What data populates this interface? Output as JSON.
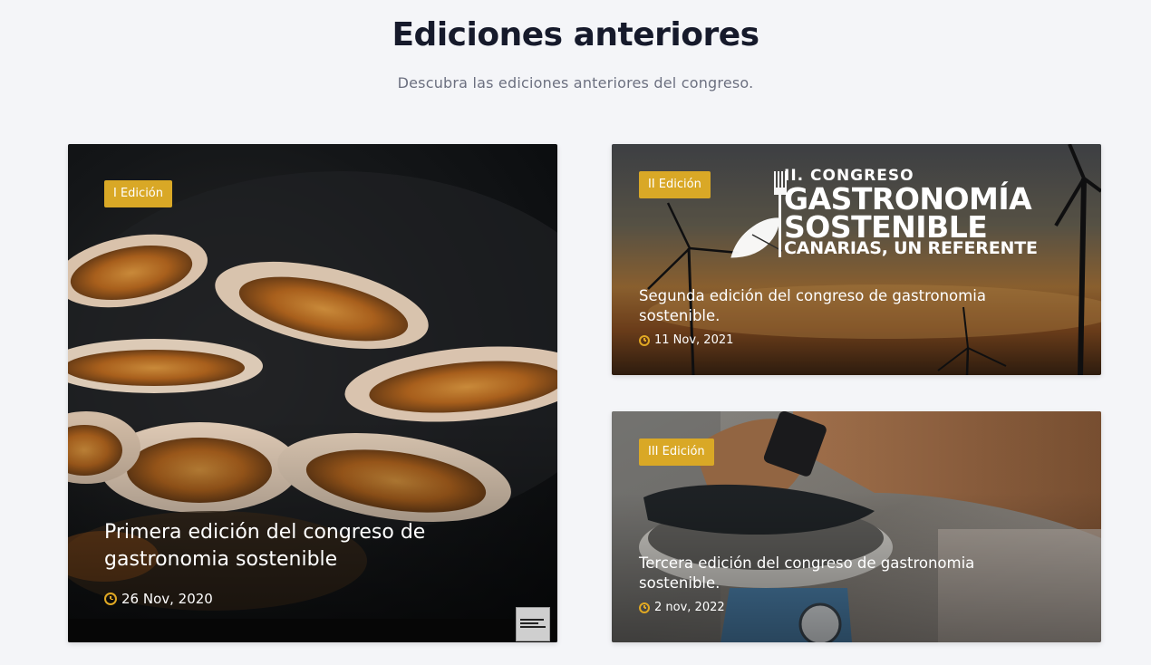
{
  "section": {
    "title": "Ediciones anteriores",
    "subtitle": "Descubra las ediciones anteriores del congreso."
  },
  "editions": [
    {
      "badge": "I Edición",
      "title": "Primera edición del congreso de gastronomia sostenible",
      "date": "26 Nov, 2020",
      "image": "scallops-on-dark-pan-photo"
    },
    {
      "badge": "II Edición",
      "title": "Segunda edición del congreso de gastronomia sostenible.",
      "date": "11 Nov, 2021",
      "image": "wind-turbines-sunset-photo",
      "logo": {
        "line1": "II. CONGRESO",
        "line2": "GASTRONOMÍA",
        "line3": "SOSTENIBLE",
        "line4": "CANARIAS, UN REFERENTE"
      }
    },
    {
      "badge": "III Edición",
      "title": "Tercera edición del congreso de gastronomia sostenible.",
      "date": "2 nov, 2022",
      "image": "fish-on-weighing-scale-photo"
    }
  ],
  "colors": {
    "accent": "#d9a826",
    "background": "#f4f5f8",
    "title": "#161a2b",
    "subtitle": "#6c7080"
  }
}
